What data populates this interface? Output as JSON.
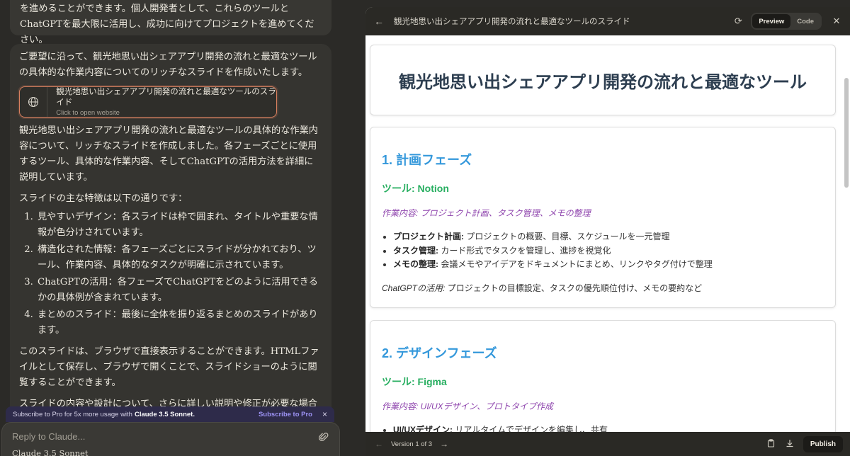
{
  "chat": {
    "prev_message": "を進めることができます。個人開発者として、これらのツールとChatGPTを最大限に活用し、成功に向けてプロジェクトを進めてください。",
    "intro": "ご要望に沿って、観光地思い出シェアアプリ開発の流れと最適なツールの具体的な作業内容についてのリッチなスライドを作成いたします。",
    "artifact_card": {
      "title": "観光地思い出シェアアプリ開発の流れと最適なツールのスライド",
      "subtitle": "Click to open website",
      "icon": "globe-icon"
    },
    "para1": "観光地思い出シェアアプリ開発の流れと最適なツールの具体的な作業内容について、リッチなスライドを作成しました。各フェーズごとに使用するツール、具体的な作業内容、そしてChatGPTの活用方法を詳細に説明しています。",
    "features_heading": "スライドの主な特徴は以下の通りです：",
    "features": [
      "見やすいデザイン：各スライドは枠で囲まれ、タイトルや重要な情報が色分けされています。",
      "構造化された情報：各フェーズごとにスライドが分かれており、ツール、作業内容、具体的なタスクが明確に示されています。",
      "ChatGPTの活用：各フェーズでChatGPTをどのように活用できるかの具体例が含まれています。",
      "まとめのスライド：最後に全体を振り返るまとめのスライドがあります。"
    ],
    "para2": "このスライドは、ブラウザで直接表示することができます。HTMLファイルとして保存し、ブラウザで開くことで、スライドショーのように閲覧することができます。",
    "para3": "スライドの内容や設計について、さらに詳しい説明や修正が必要な場合は、お知らせください。また、特定のセクションについてより詳細な情報が必要"
  },
  "banner": {
    "text": "Subscribe to Pro for 5x more usage with",
    "model": "Claude 3.5 Sonnet.",
    "cta": "Subscribe to Pro",
    "close": "×"
  },
  "composer": {
    "placeholder": "Reply to Claude...",
    "model": "Claude 3.5 Sonnet"
  },
  "artifact": {
    "header_title": "観光地思い出シェアアプリ開発の流れと最適なツールのスライド",
    "tabs": {
      "preview": "Preview",
      "code": "Code"
    },
    "slide_title": "観光地思い出シェアアプリ開発の流れと最適なツール",
    "slides": [
      {
        "phase": "1. 計画フェーズ",
        "tool": "ツール: Notion",
        "task": "作業内容: プロジェクト計画、タスク管理、メモの整理",
        "items": [
          {
            "label": "プロジェクト計画:",
            "text": " プロジェクトの概要、目標、スケジュールを一元管理"
          },
          {
            "label": "タスク管理:",
            "text": " カード形式でタスクを管理し、進捗を視覚化"
          },
          {
            "label": "メモの整理:",
            "text": " 会議メモやアイデアをドキュメントにまとめ、リンクやタグ付けで整理"
          }
        ],
        "gpt_label": "ChatGPTの活用:",
        "gpt_text": " プロジェクトの目標設定、タスクの優先順位付け、メモの要約など"
      },
      {
        "phase": "2. デザインフェーズ",
        "tool": "ツール: Figma",
        "task": "作業内容: UI/UXデザイン、プロトタイプ作成",
        "items": [
          {
            "label": "UI/UXデザイン:",
            "text": " リアルタイムでデザインを編集し、共有"
          }
        ]
      }
    ],
    "footer": {
      "version": "Version 1 of 3",
      "publish": "Publish"
    }
  }
}
